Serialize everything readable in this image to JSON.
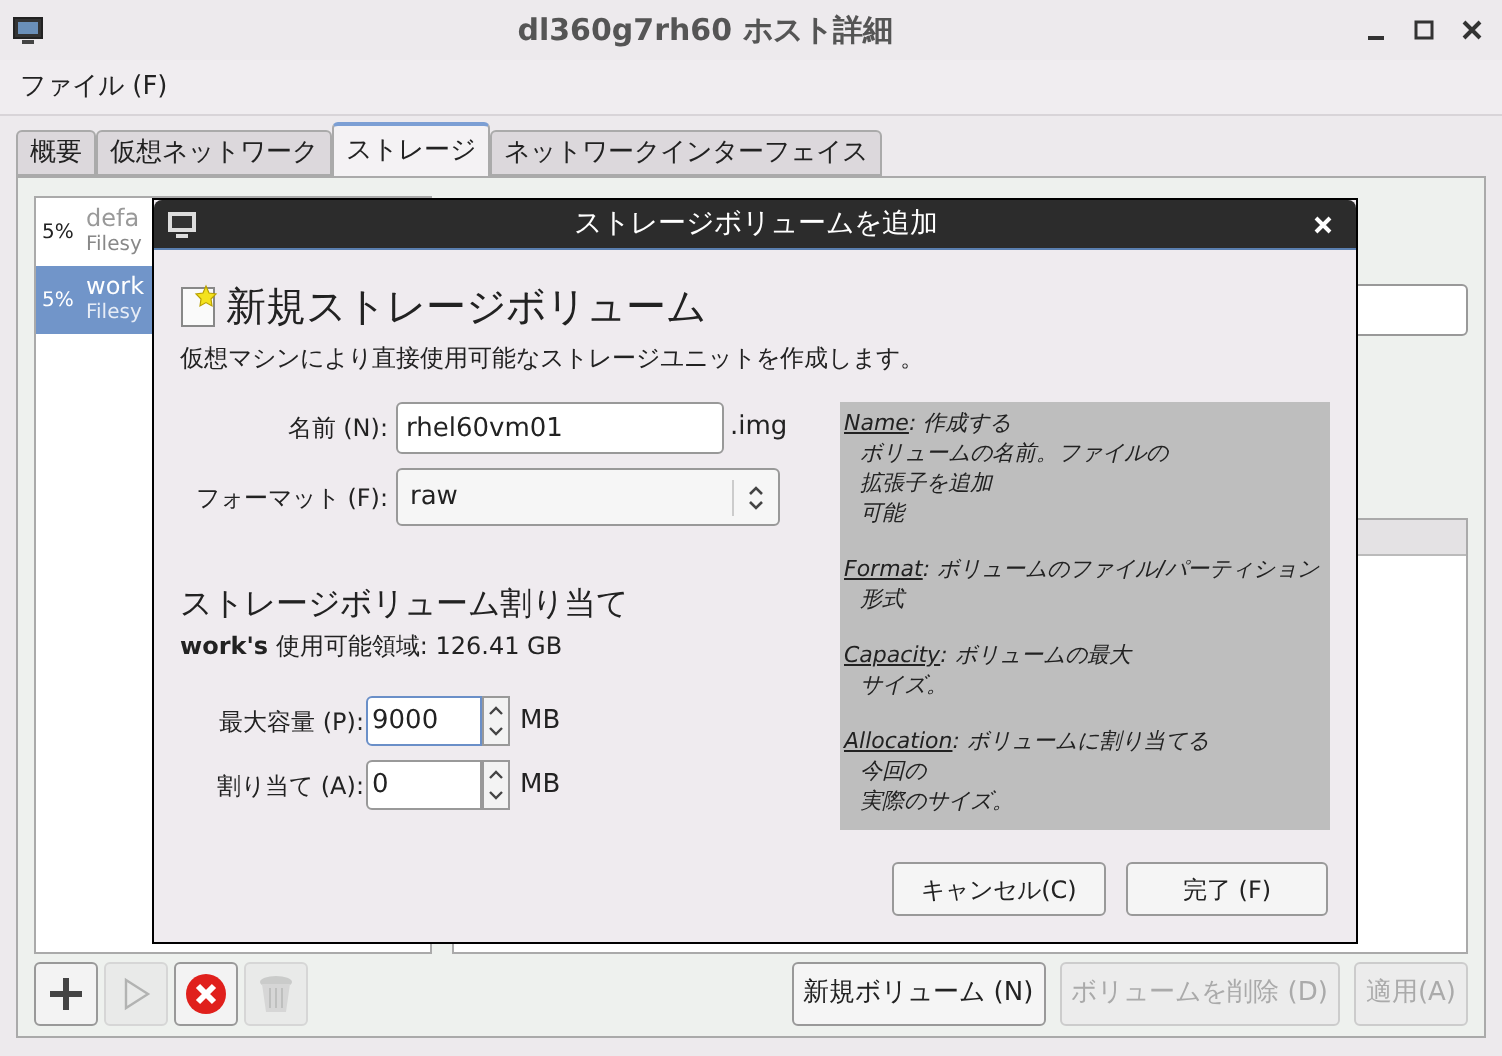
{
  "window": {
    "title": "dl360g7rh60 ホスト詳細"
  },
  "menu": [
    "ファイル (F)"
  ],
  "tabs": [
    {
      "label": "概要",
      "selected": false
    },
    {
      "label": "仮想ネットワーク",
      "selected": false
    },
    {
      "label": "ストレージ",
      "selected": true
    },
    {
      "label": "ネットワークインターフェイス",
      "selected": false
    }
  ],
  "pools": [
    {
      "percent": "5%",
      "name": "defa",
      "type": "Filesy",
      "selected": false
    },
    {
      "percent": "5%",
      "name": "work",
      "type": "Filesy",
      "selected": true
    }
  ],
  "toolbar": [
    {
      "kind": "add",
      "disabled": false
    },
    {
      "kind": "start",
      "disabled": true
    },
    {
      "kind": "stop",
      "disabled": false
    },
    {
      "kind": "delete",
      "disabled": true
    }
  ],
  "buttons": [
    {
      "label": "新規ボリューム (N)",
      "disabled": false
    },
    {
      "label": "ボリュームを削除 (D)",
      "disabled": true
    },
    {
      "label": "適用(A)",
      "disabled": true
    }
  ],
  "dialog": {
    "title": "ストレージボリュームを追加",
    "heading": "新規ストレージボリューム",
    "subtitle": "仮想マシンにより直接使用可能なストレージユニットを作成します。",
    "name": {
      "label": "名前 (N):",
      "value": "rhel60vm01",
      "suffix": ".img"
    },
    "format": {
      "label": "フォーマット (F):",
      "value": "raw"
    },
    "allocation_heading": "ストレージボリューム割り当て",
    "available": "**work's** 使用可能領域: 126.41 GB",
    "spins": [
      {
        "label": "最大容量 (P):",
        "value": "9000",
        "unit": "MB",
        "focused": true
      },
      {
        "label": "割り当て (A):",
        "value": "0",
        "unit": "MB",
        "focused": false
      }
    ],
    "help": [
      {
        "term": "Name",
        "lines": [
          ": 作成する",
          "ボリュームの名前。ファイルの",
          "拡張子を追加",
          "可能"
        ]
      },
      {
        "term": "Format",
        "lines": [
          ": ボリュームのファイル/パーティション",
          "形式"
        ]
      },
      {
        "term": "Capacity",
        "lines": [
          ": ボリュームの最大",
          "サイズ。"
        ]
      },
      {
        "term": "Allocation",
        "lines": [
          ": ボリュームに割り当てる",
          "今回の",
          "実際のサイズ。"
        ]
      }
    ],
    "buttons": [
      "キャンセル(C)",
      "完了 (F)"
    ]
  }
}
